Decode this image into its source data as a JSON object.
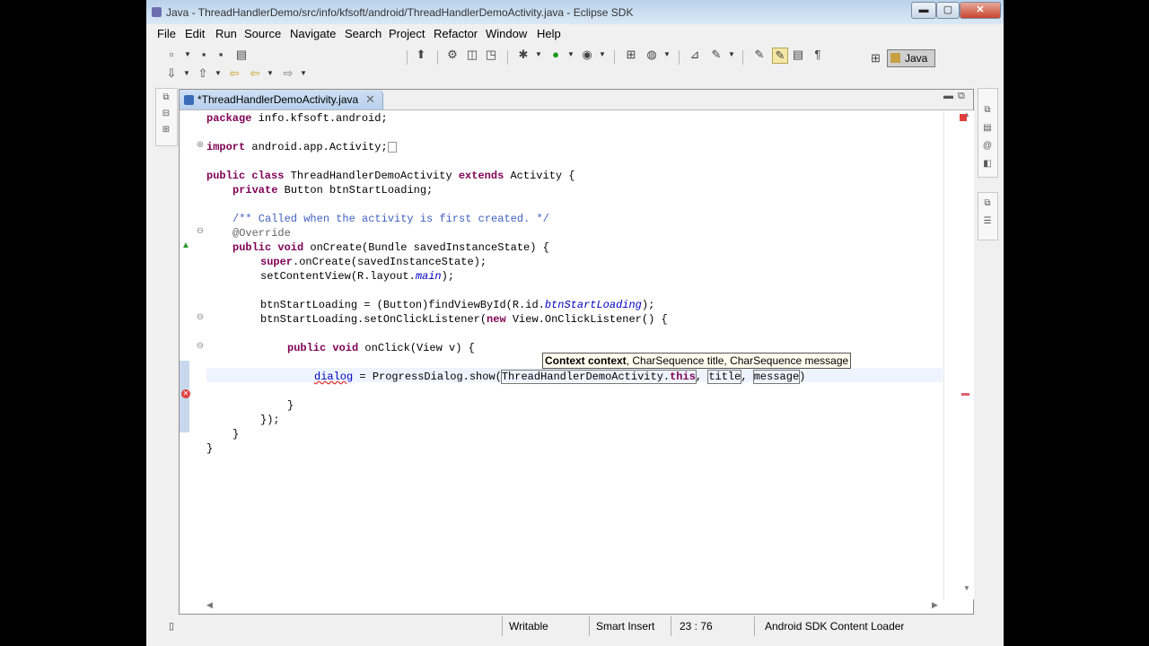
{
  "window": {
    "title": "Java - ThreadHandlerDemo/src/info/kfsoft/android/ThreadHandlerDemoActivity.java - Eclipse SDK",
    "controls": {
      "minimize": "▬",
      "maximize": "▢",
      "close": "✕"
    }
  },
  "menu": [
    "File",
    "Edit",
    "Run",
    "Source",
    "Navigate",
    "Search",
    "Project",
    "Refactor",
    "Window",
    "Help"
  ],
  "toolbar": {
    "perspective_label": "Java",
    "icons_row1": [
      "new-icon",
      "save-icon",
      "save-all-icon",
      "print-icon",
      "new-java-project-icon",
      "new-package-icon",
      "new-class-icon",
      "android-sdk-icon",
      "debug-icon",
      "run-icon",
      "external-tools-icon",
      "new-class-wizard-icon",
      "new-interface-icon",
      "open-type-icon",
      "search-icon",
      "toggle-mark-occurrences-icon",
      "toggle-block-selection-icon",
      "show-whitespace-icon"
    ],
    "icons_row2": [
      "next-annotation-icon",
      "previous-annotation-icon",
      "last-edit-location-icon",
      "back-icon",
      "forward-icon"
    ]
  },
  "editor": {
    "tab_label": "*ThreadHandlerDemoActivity.java",
    "tooltip": {
      "bold": "Context context",
      "rest": ", CharSequence title, CharSequence message"
    },
    "code": {
      "l1_kw": "package",
      "l1_rest": " info.kfsoft.android;",
      "l2_kw": "import",
      "l2_rest": " android.app.Activity;",
      "l3_kw1": "public class",
      "l3_name": " ThreadHandlerDemoActivity ",
      "l3_kw2": "extends",
      "l3_rest": " Activity {",
      "l4_kw": "private",
      "l4_rest": " Button btnStartLoading;",
      "l5_comment": "/** Called when the activity is first created. */",
      "l6_ann": "@Override",
      "l7_kw": "public void",
      "l7_rest": " onCreate(Bundle savedInstanceState) {",
      "l8_kw": "super",
      "l8_rest": ".onCreate(savedInstanceState);",
      "l9_a": "setContentView(R.layout.",
      "l9_fld": "main",
      "l9_b": ");",
      "l10_a": "btnStartLoading = (Button)findViewById(R.id.",
      "l10_fld": "btnStartLoading",
      "l10_b": ");",
      "l11_a": "btnStartLoading.setOnClickListener(",
      "l11_kw": "new",
      "l11_b": " View.OnClickListener() {",
      "l12_kw": "public void",
      "l12_rest": " onClick(View v) {",
      "l13_err": "dialog",
      "l13_a": " = ProgressDialog.show(",
      "l13_arg1": "ThreadHandlerDemoActivity.",
      "l13_this": "this",
      "l13_sep1": ", ",
      "l13_arg2": "title",
      "l13_sep2": ", ",
      "l13_arg3": "message",
      "l13_end": ")",
      "l14": "}",
      "l15": "});",
      "l16": "}",
      "l17": "}"
    }
  },
  "status": {
    "writable": "Writable",
    "insert_mode": "Smart Insert",
    "position": "23 : 76",
    "task": "Android SDK Content Loader"
  }
}
